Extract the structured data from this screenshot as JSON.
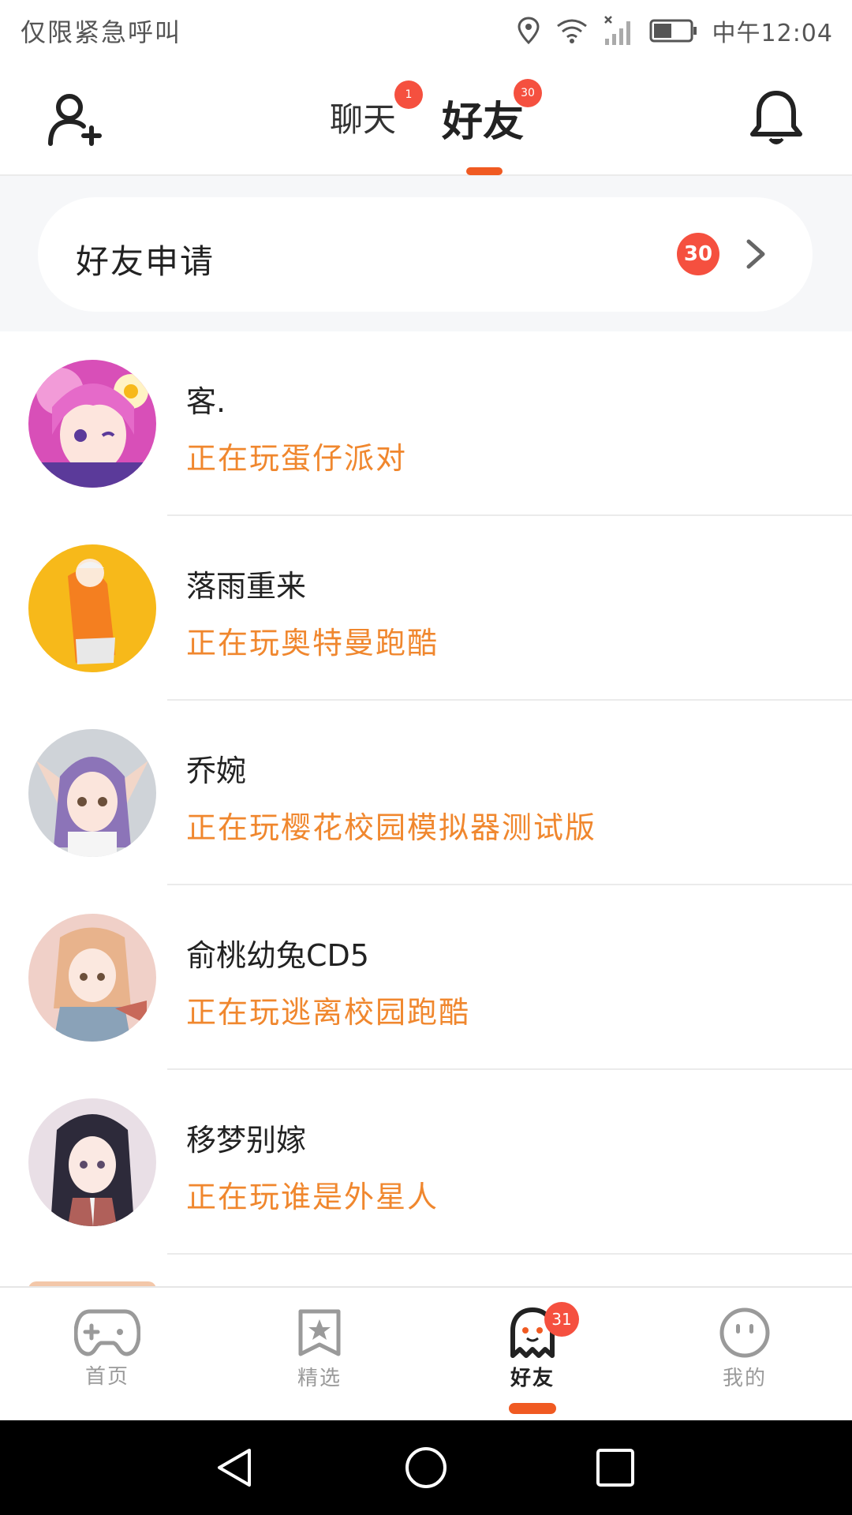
{
  "status_bar": {
    "left_text": "仅限紧急呼叫",
    "time": "中午12:04",
    "icons": [
      "location-icon",
      "wifi-icon",
      "signal-off-icon",
      "battery-icon"
    ]
  },
  "header": {
    "tabs": [
      {
        "label": "聊天",
        "badge": "1",
        "active": false
      },
      {
        "label": "好友",
        "badge": "30",
        "active": true
      }
    ],
    "left_icon": "add-friend-icon",
    "right_icon": "bell-icon",
    "accent_color": "#f05a22"
  },
  "friend_requests": {
    "label": "好友申请",
    "count": "30"
  },
  "friends": [
    {
      "name": "客.",
      "status": "正在玩蛋仔派对",
      "avatar_colors": [
        "#d84fb8",
        "#5b3a9a"
      ]
    },
    {
      "name": "落雨重来",
      "status": "正在玩奥特曼跑酷",
      "avatar_colors": [
        "#f7b91a",
        "#f47f20"
      ]
    },
    {
      "name": "乔婉",
      "status": "正在玩樱花校园模拟器测试版",
      "avatar_colors": [
        "#cfd3d8",
        "#8c74b8"
      ]
    },
    {
      "name": "俞桃幼兔CD5",
      "status": "正在玩逃离校园跑酷",
      "avatar_colors": [
        "#f0d0c8",
        "#e8b38c"
      ]
    },
    {
      "name": "移梦别嫁",
      "status": "正在玩谁是外星人",
      "avatar_colors": [
        "#e9dfe6",
        "#2d2a3a"
      ]
    }
  ],
  "bottom_nav": {
    "items": [
      {
        "label": "首页",
        "icon": "gamepad-icon"
      },
      {
        "label": "精选",
        "icon": "star-badge-icon"
      },
      {
        "label": "好友",
        "icon": "ghost-icon",
        "badge": "31",
        "active": true
      },
      {
        "label": "我的",
        "icon": "smiley-icon"
      }
    ]
  },
  "system_nav": {
    "icons": [
      "back-icon",
      "home-icon",
      "recents-icon"
    ]
  },
  "colors": {
    "badge": "#f5503f",
    "status_text": "#f0872e",
    "section_bg": "#f6f7f9"
  }
}
